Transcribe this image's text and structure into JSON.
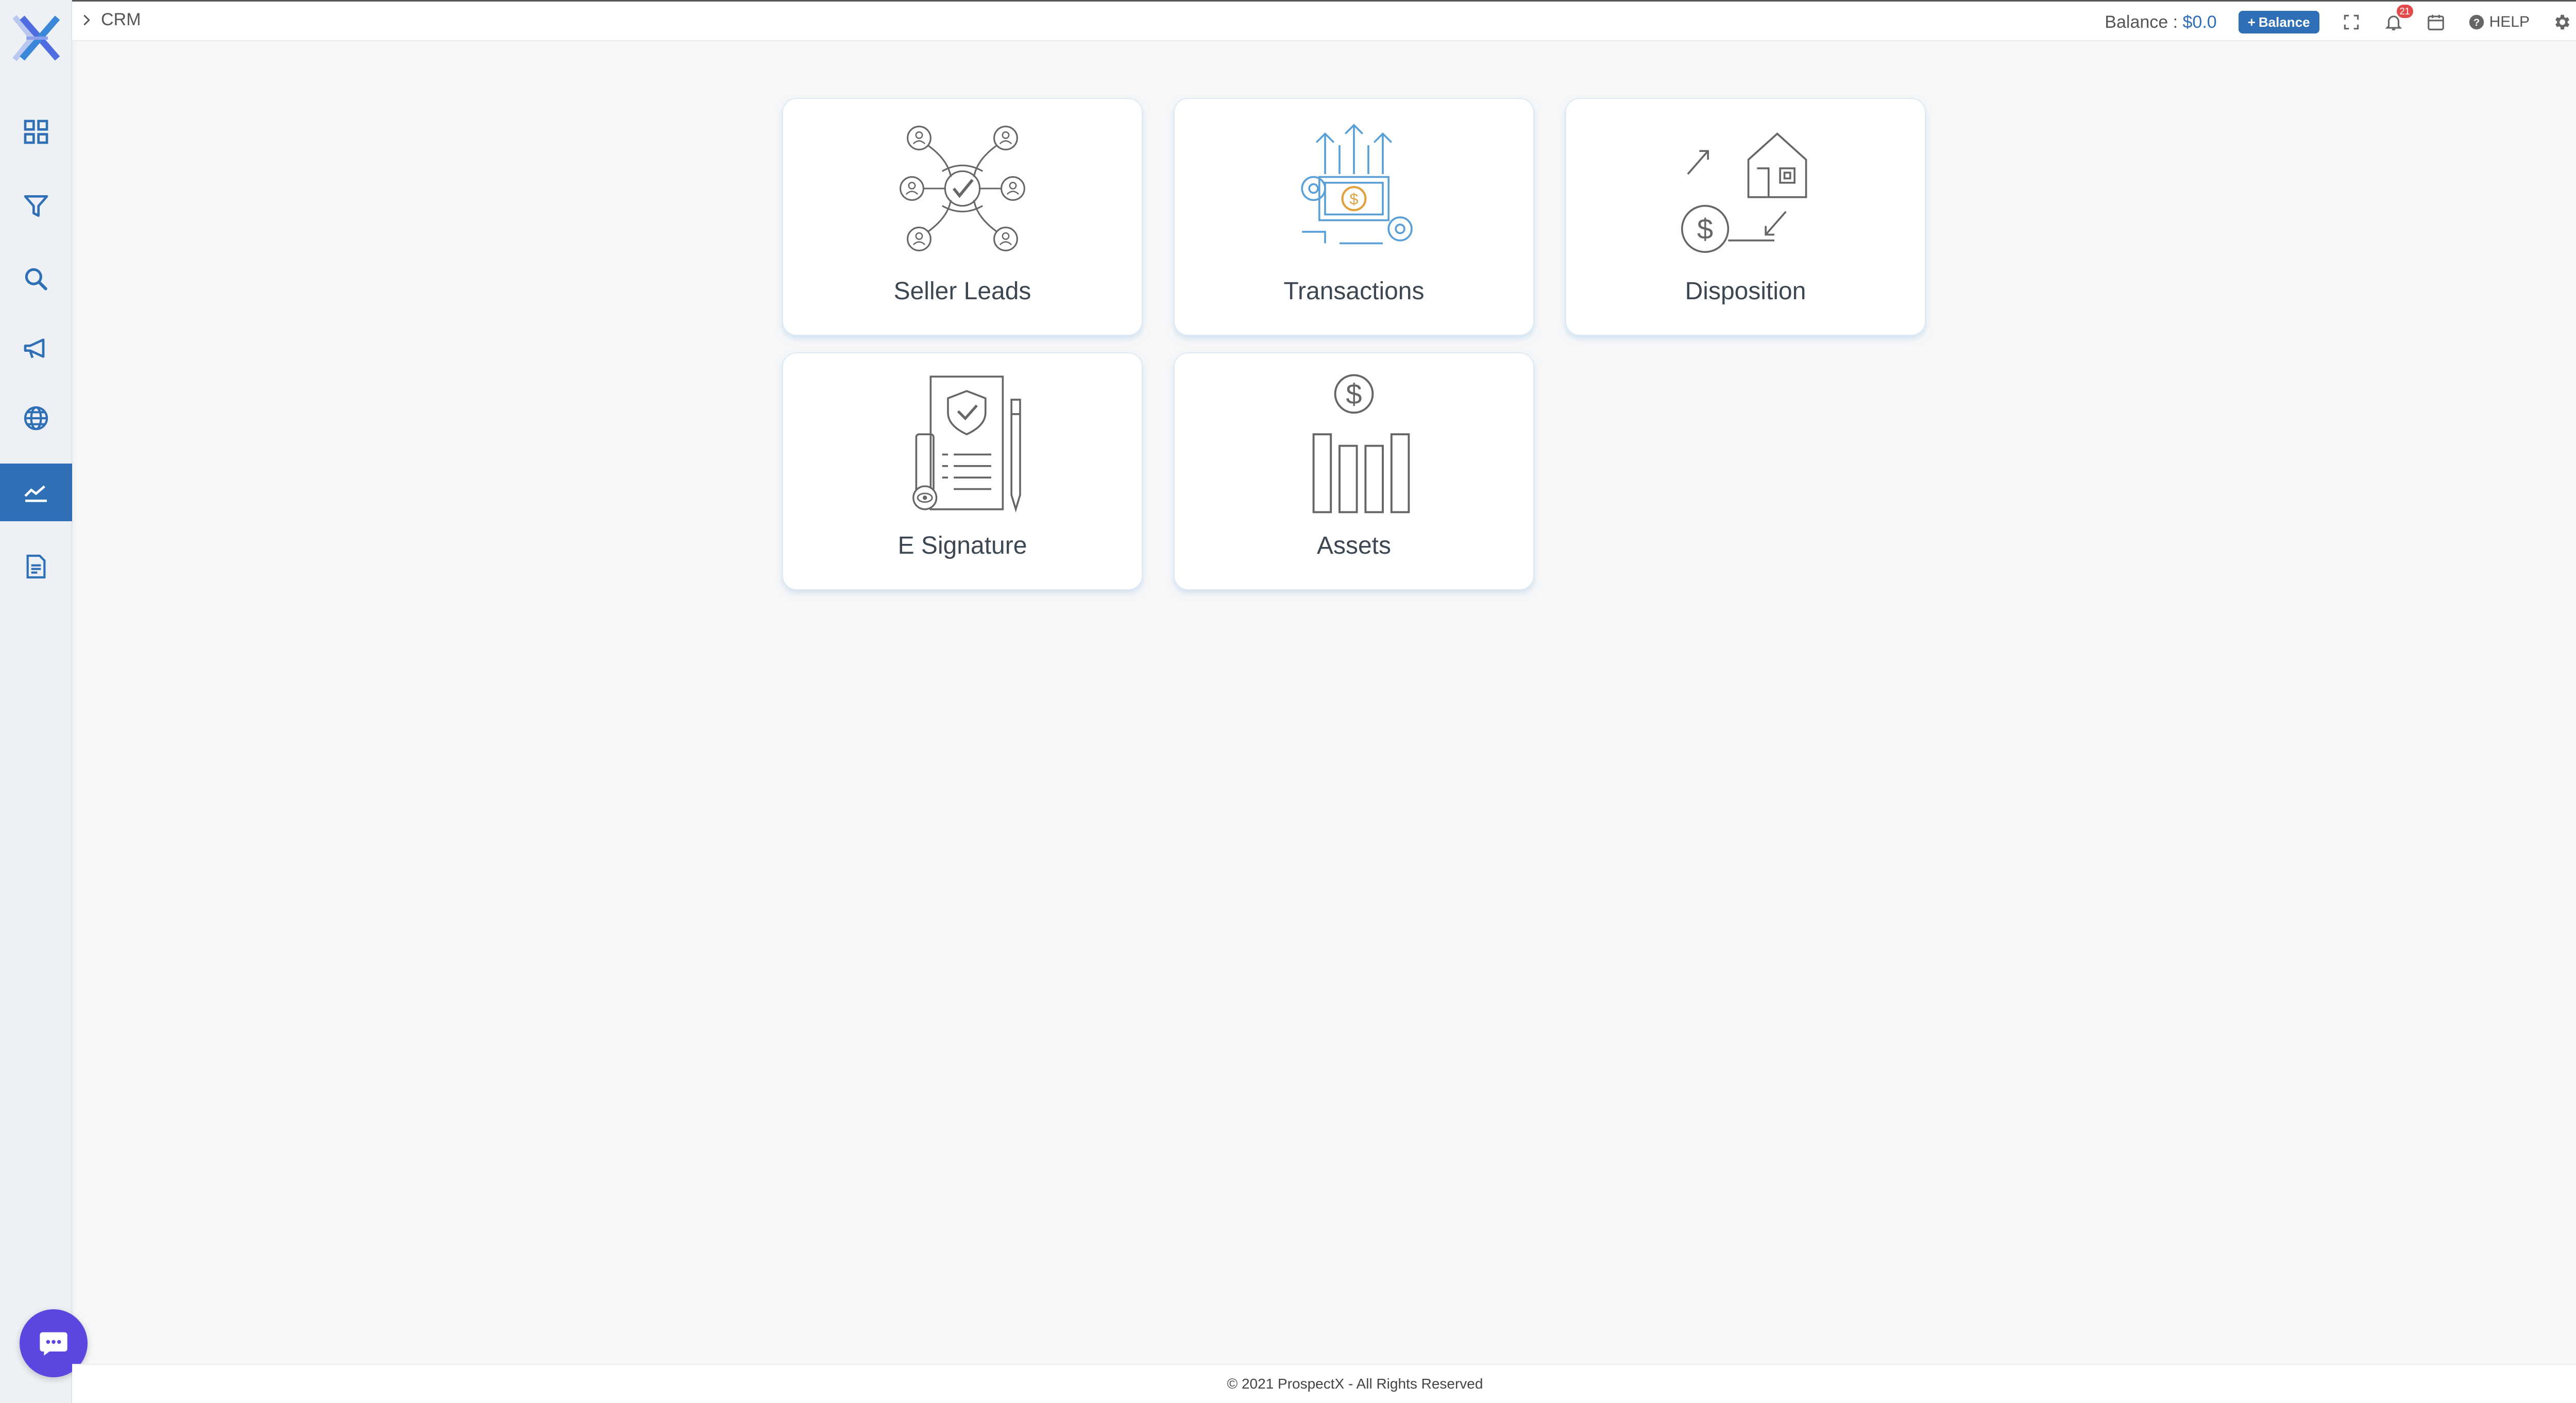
{
  "app": {
    "logo_name": "ProspectX logo",
    "accent_color": "#2f6fb6"
  },
  "sidebar": {
    "items": [
      {
        "name": "dashboard",
        "icon": "grid-icon",
        "active": false
      },
      {
        "name": "filter",
        "icon": "filter-icon",
        "active": false
      },
      {
        "name": "search",
        "icon": "search-icon",
        "active": false
      },
      {
        "name": "campaigns",
        "icon": "megaphone-icon",
        "active": false
      },
      {
        "name": "web",
        "icon": "globe-icon",
        "active": false
      },
      {
        "name": "crm",
        "icon": "chart-line-icon",
        "active": true
      },
      {
        "name": "documents",
        "icon": "document-icon",
        "active": false
      }
    ]
  },
  "header": {
    "breadcrumb": "CRM",
    "balance_label": "Balance : ",
    "balance_value": "$0.0",
    "add_balance_label": "Balance",
    "notification_count": "21",
    "help_label": "HELP"
  },
  "cards": [
    {
      "label": "Seller Leads",
      "icon": "seller-leads-illustration"
    },
    {
      "label": "Transactions",
      "icon": "transactions-illustration"
    },
    {
      "label": "Disposition",
      "icon": "disposition-illustration"
    },
    {
      "label": "E Signature",
      "icon": "e-signature-illustration"
    },
    {
      "label": "Assets",
      "icon": "assets-illustration"
    }
  ],
  "footer": {
    "copyright": "© 2021 ProspectX - All Rights Reserved"
  }
}
